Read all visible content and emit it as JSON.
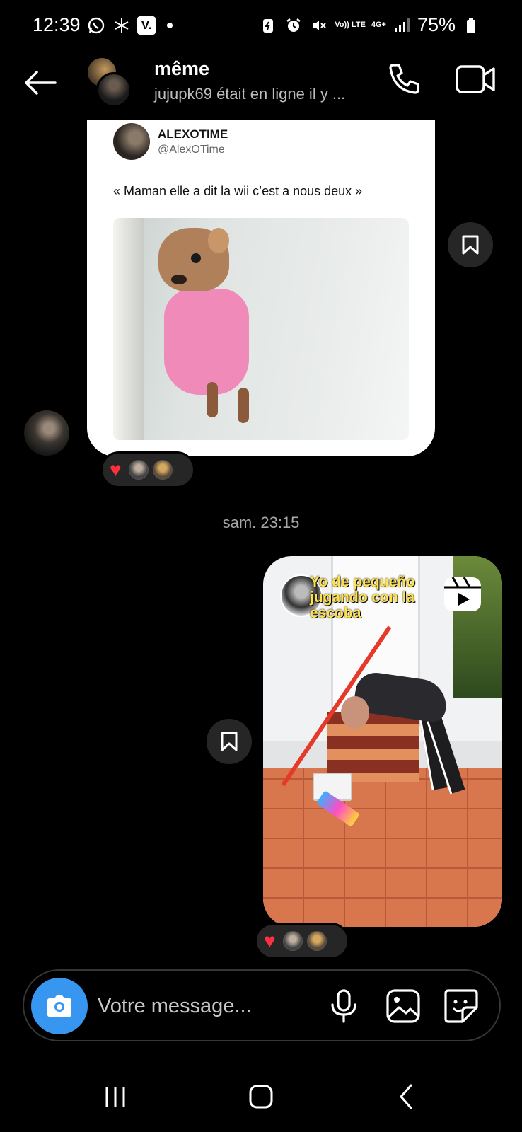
{
  "status_bar": {
    "time": "12:39",
    "battery": "75%",
    "network": "4G+",
    "volte": "Vo)) LTE",
    "left_icons": [
      "whatsapp-icon",
      "snowflake-icon",
      "vinted-icon"
    ],
    "right_icons": [
      "battery-saver-icon",
      "alarm-icon",
      "mute-icon",
      "signal-icon",
      "battery-icon"
    ]
  },
  "header": {
    "name": "même",
    "status": "jujupk69 était en ligne il y ..."
  },
  "tweet": {
    "author_name": "ALEXOTIME",
    "author_handle": "@AlexOTime",
    "text": "« Maman elle a dit la wii c’est a nous deux »"
  },
  "timestamp": "sam. 23:15",
  "reel": {
    "caption": "Yo de pequeño jugando con la escoba"
  },
  "composer": {
    "placeholder": "Votre message..."
  },
  "colors": {
    "accent": "#3797f0",
    "heart": "#ff3040",
    "bubble": "#262626",
    "background": "#000000"
  }
}
